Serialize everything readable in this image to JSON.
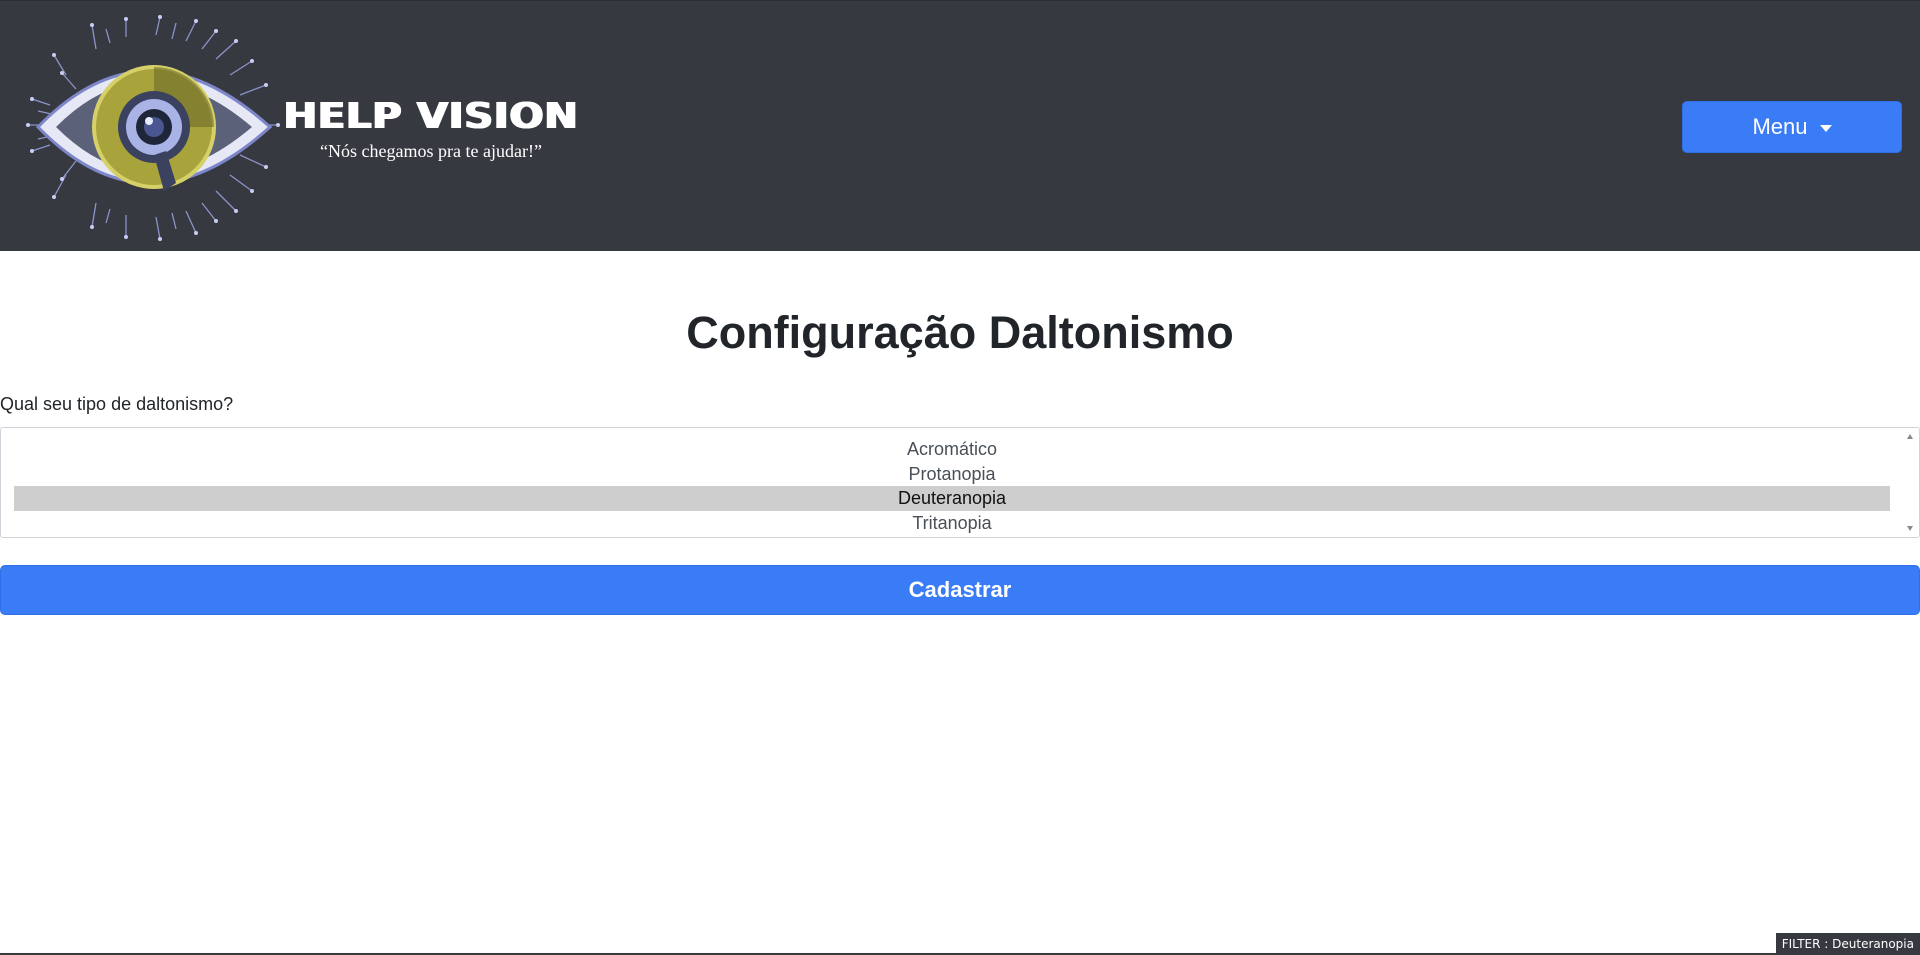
{
  "header": {
    "logo_icon": "eye-circuit-logo",
    "brand_title": "HELP VISION",
    "tagline": "“Nós chegamos pra te ajudar!”",
    "menu_label": "Menu",
    "menu_icon": "caret-down-icon",
    "background_color": "#363940",
    "accent_color": "#3a7bf6"
  },
  "main": {
    "title_regular": "Configuração",
    "title_bold": "Daltonismo",
    "question": "Qual seu tipo de daltonismo?",
    "options": [
      "Acromático",
      "Protanopia",
      "Deuteranopia",
      "Tritanopia"
    ],
    "selected_option": "Deuteranopia",
    "submit_label": "Cadastrar"
  },
  "status": {
    "filter_text": "FILTER : Deuteranopia"
  }
}
